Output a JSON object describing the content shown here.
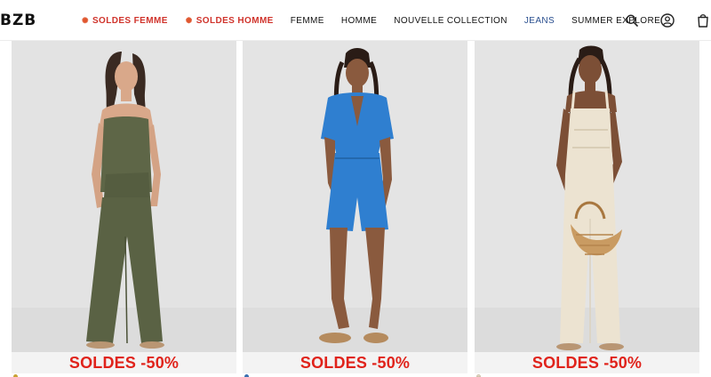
{
  "brand": {
    "logo": "BZB"
  },
  "nav": {
    "items": [
      {
        "label": "SOLDES FEMME",
        "kind": "sale"
      },
      {
        "label": "SOLDES HOMME",
        "kind": "sale"
      },
      {
        "label": "FEMME",
        "kind": "normal"
      },
      {
        "label": "HOMME",
        "kind": "normal"
      },
      {
        "label": "NOUVELLE COLLECTION",
        "kind": "normal"
      },
      {
        "label": "JEANS",
        "kind": "highlight"
      },
      {
        "label": "SUMMER EXPLORE",
        "kind": "normal"
      }
    ],
    "sale_icon": "fire-icon"
  },
  "header_icons": [
    "search-icon",
    "account-icon",
    "cart-icon"
  ],
  "colors": {
    "sale_red": "#e0231b",
    "nav_sale_red": "#d0342c",
    "jeans_blue": "#2a4f8f",
    "photo_background": "#e4e4e4"
  },
  "products": [
    {
      "badge": "SOLDES -50%",
      "garment": "olive strapless wide-leg jumpsuit",
      "swatch_color": "#c9a233"
    },
    {
      "badge": "SOLDES -50%",
      "garment": "blue short-sleeve romper",
      "swatch_color": "#3a6fb0"
    },
    {
      "badge": "SOLDES -50%",
      "garment": "cream sleeveless wide-leg jumpsuit with woven bag",
      "swatch_color": "#e8dcc6"
    }
  ]
}
